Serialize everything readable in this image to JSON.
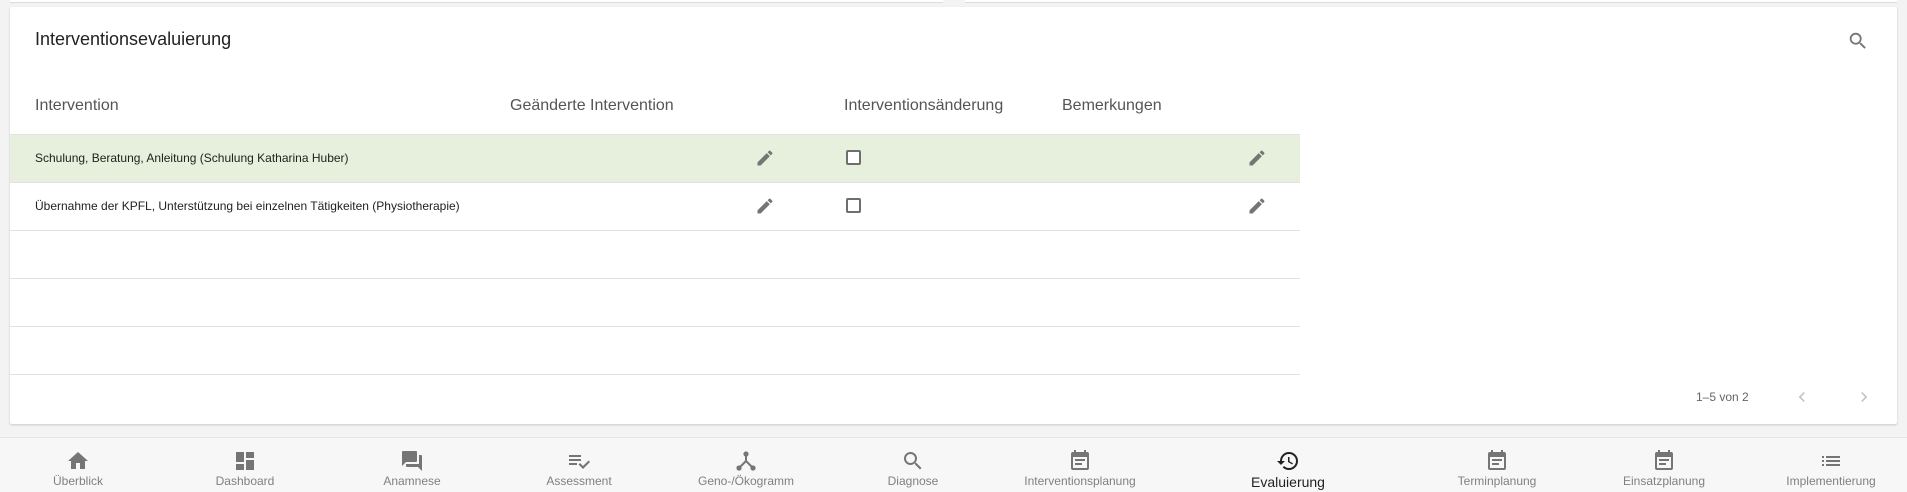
{
  "card": {
    "title": "Interventionsevaluierung"
  },
  "table": {
    "headers": {
      "intervention": "Intervention",
      "changed": "Geänderte Intervention",
      "change_flag": "Interventionsänderung",
      "remarks": "Bemerkungen"
    },
    "rows": [
      {
        "intervention": "Schulung, Beratung, Anleitung (Schulung Katharina Huber)",
        "changed_checked": false,
        "selected": true
      },
      {
        "intervention": "Übernahme der KPFL, Unterstützung bei einzelnen Tätigkeiten (Physiotherapie)",
        "changed_checked": false,
        "selected": false
      }
    ],
    "empty_rows": 3
  },
  "pagination": {
    "range_text": "1–5 von 2"
  },
  "nav": {
    "active": "Evaluierung",
    "items": [
      {
        "label": "Überblick",
        "icon": "home-icon"
      },
      {
        "label": "Dashboard",
        "icon": "dashboard-icon"
      },
      {
        "label": "Anamnese",
        "icon": "chat-icon"
      },
      {
        "label": "Assessment",
        "icon": "playlist-check-icon"
      },
      {
        "label": "Geno-/Ökogramm",
        "icon": "network-icon"
      },
      {
        "label": "Diagnose",
        "icon": "search-icon"
      },
      {
        "label": "Interventionsplanung",
        "icon": "calendar-icon"
      },
      {
        "label": "Evaluierung",
        "icon": "history-icon"
      },
      {
        "label": "Terminplanung",
        "icon": "calendar-icon"
      },
      {
        "label": "Einsatzplanung",
        "icon": "calendar-icon"
      },
      {
        "label": "Implementierung",
        "icon": "list-icon"
      }
    ]
  },
  "colors": {
    "selected_row": "#e6f0dc",
    "icon_gray": "#757575"
  }
}
